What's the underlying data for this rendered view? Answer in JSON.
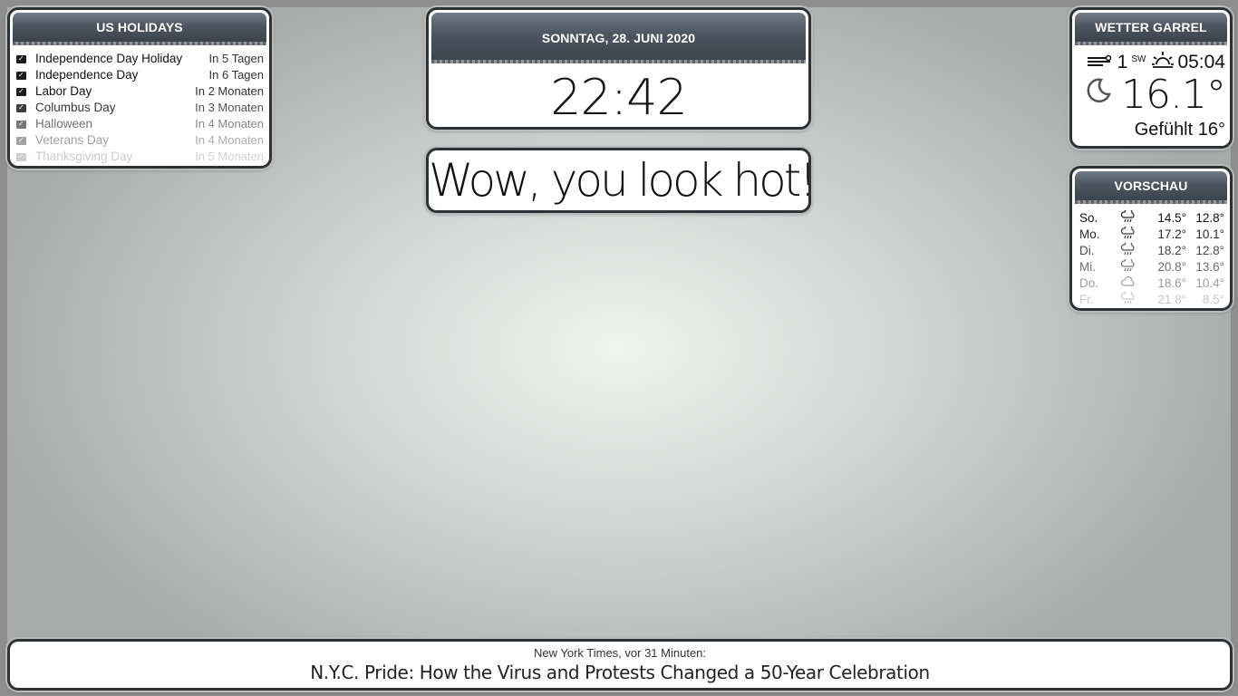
{
  "holidays": {
    "title": "US HOLIDAYS",
    "items": [
      {
        "name": "Independence Day Holiday",
        "when": "In 5 Tagen"
      },
      {
        "name": "Independence Day",
        "when": "In 6 Tagen"
      },
      {
        "name": "Labor Day",
        "when": "In 2 Monaten"
      },
      {
        "name": "Columbus Day",
        "when": "In 3 Monaten"
      },
      {
        "name": "Halloween",
        "when": "In 4 Monaten"
      },
      {
        "name": "Veterans Day",
        "when": "In 4 Monaten"
      },
      {
        "name": "Thanksgiving Day",
        "when": "In 5 Monaten"
      }
    ]
  },
  "clock": {
    "date": "SONNTAG, 28. JUNI 2020",
    "time": "22:42"
  },
  "compliment": {
    "text": "Wow, you look hot!"
  },
  "weather": {
    "title": "WETTER GARREL",
    "wind_speed": "1",
    "wind_direction": "SW",
    "sunrise": "05:04",
    "temperature": "16.1°",
    "feels_like": "Gefühlt 16°",
    "icons": {
      "wind": "wind-icon",
      "sun": "sunrise-icon",
      "condition": "moon-icon"
    }
  },
  "forecast": {
    "title": "VORSCHAU",
    "days": [
      {
        "day": "So.",
        "icon": "rain-icon",
        "max": "14.5°",
        "min": "12.8°"
      },
      {
        "day": "Mo.",
        "icon": "rain-icon",
        "max": "17.2°",
        "min": "10.1°"
      },
      {
        "day": "Di.",
        "icon": "rain-icon",
        "max": "18.2°",
        "min": "12.8°"
      },
      {
        "day": "Mi.",
        "icon": "rain-icon",
        "max": "20.8°",
        "min": "13.6°"
      },
      {
        "day": "Do.",
        "icon": "cloud-icon",
        "max": "18.6°",
        "min": "10.4°"
      },
      {
        "day": "Fr.",
        "icon": "rain-icon",
        "max": "21.8°",
        "min": "8.5°"
      }
    ]
  },
  "news": {
    "source": "New York Times, vor 31 Minuten:",
    "headline": "N.Y.C. Pride: How the Virus and Protests Changed a 50-Year Celebration"
  }
}
